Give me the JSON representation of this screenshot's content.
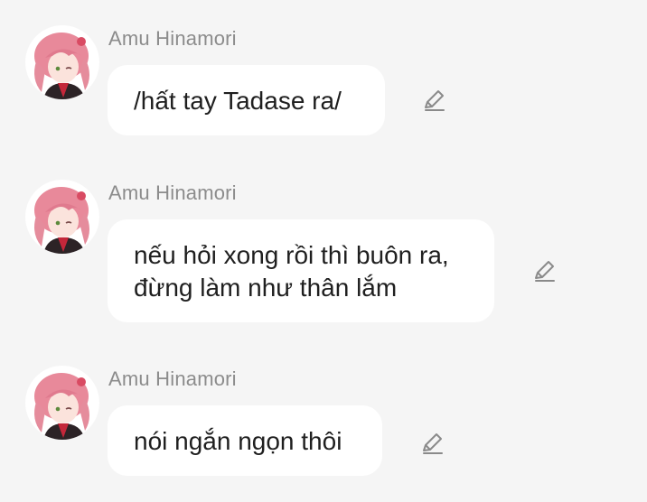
{
  "messages": [
    {
      "sender": "Amu Hinamori",
      "lines": [
        "/hất tay Tadase ra/"
      ],
      "avatar_icon": "anime-girl-avatar",
      "action_icon": "pencil-edit-icon"
    },
    {
      "sender": "Amu Hinamori",
      "lines": [
        "nếu hỏi xong rồi thì buôn ra,",
        "đừng làm như thân lắm"
      ],
      "avatar_icon": "anime-girl-avatar",
      "action_icon": "pencil-edit-icon"
    },
    {
      "sender": "Amu Hinamori",
      "lines": [
        "nói ngắn ngọn thôi"
      ],
      "avatar_icon": "anime-girl-avatar",
      "action_icon": "pencil-edit-icon"
    }
  ],
  "colors": {
    "background": "#f5f5f5",
    "bubble": "#ffffff",
    "sender_text": "#8c8c8c",
    "message_text": "#1f1f1f",
    "hair": "#e8899a",
    "icon": "#8a8a8a"
  }
}
